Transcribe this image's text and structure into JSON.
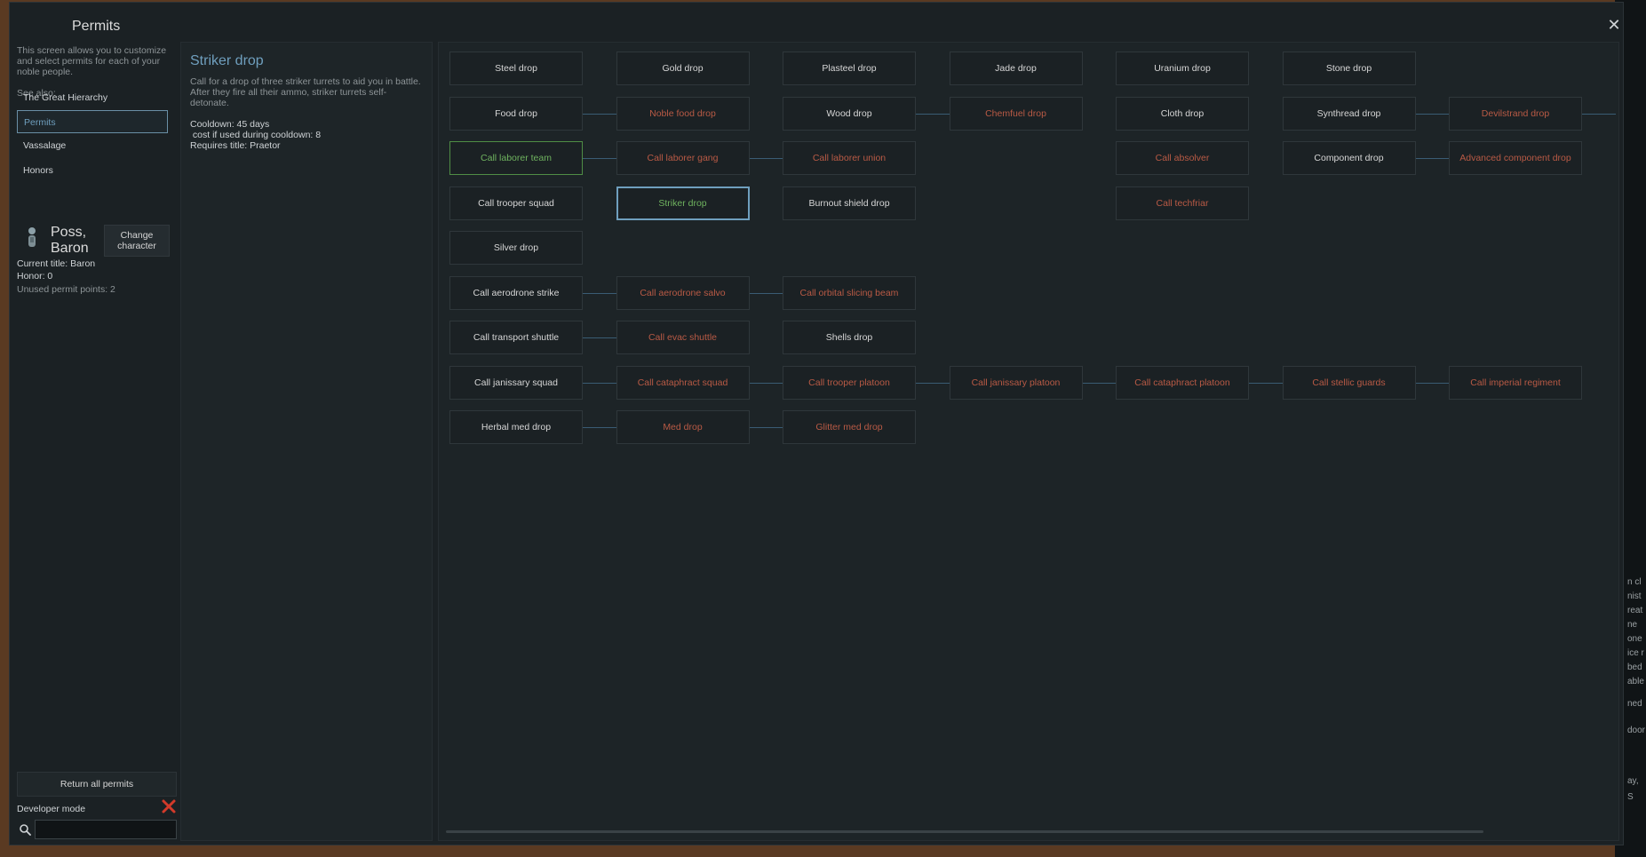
{
  "window": {
    "title": "Permits",
    "close_label": "✕"
  },
  "left": {
    "description": "This screen allows you to customize and select permits for each of your noble people.",
    "see_also": "See also:",
    "nav": [
      "The Great Hierarchy",
      "Permits",
      "Vassalage",
      "Honors"
    ],
    "noble_name": "Poss, Baron",
    "change_character": "Change character",
    "current_title": "Current title: Baron",
    "honor": "Honor: 0",
    "unused_points": "Unused permit points: 2",
    "return_all": "Return all permits",
    "developer_mode": "Developer mode",
    "search_value": ""
  },
  "detail": {
    "title": "Striker drop",
    "description": "Call for a drop of three striker turrets to aid you in battle. After they fire all their ammo, striker turrets self-detonate.",
    "cooldown": "Cooldown: 45 days",
    "cooldown_cost": " cost if used during cooldown: 8",
    "requires": "Requires title: Praetor"
  },
  "permits": [
    {
      "label": "Steel drop",
      "col": 0,
      "row": 0,
      "state": "available"
    },
    {
      "label": "Gold drop",
      "col": 1,
      "row": 0,
      "state": "available"
    },
    {
      "label": "Plasteel drop",
      "col": 2,
      "row": 0,
      "state": "available"
    },
    {
      "label": "Jade drop",
      "col": 3,
      "row": 0,
      "state": "available"
    },
    {
      "label": "Uranium drop",
      "col": 4,
      "row": 0,
      "state": "available"
    },
    {
      "label": "Stone drop",
      "col": 5,
      "row": 0,
      "state": "available"
    },
    {
      "label": "Food drop",
      "col": 0,
      "row": 1,
      "state": "available"
    },
    {
      "label": "Noble food drop",
      "col": 1,
      "row": 1,
      "state": "locked"
    },
    {
      "label": "Wood drop",
      "col": 2,
      "row": 1,
      "state": "available"
    },
    {
      "label": "Chemfuel drop",
      "col": 3,
      "row": 1,
      "state": "locked"
    },
    {
      "label": "Cloth drop",
      "col": 4,
      "row": 1,
      "state": "available"
    },
    {
      "label": "Synthread drop",
      "col": 5,
      "row": 1,
      "state": "available"
    },
    {
      "label": "Devilstrand drop",
      "col": 6,
      "row": 1,
      "state": "locked"
    },
    {
      "label": "Call laborer team",
      "col": 0,
      "row": 2,
      "state": "owned"
    },
    {
      "label": "Call laborer gang",
      "col": 1,
      "row": 2,
      "state": "locked"
    },
    {
      "label": "Call laborer union",
      "col": 2,
      "row": 2,
      "state": "locked"
    },
    {
      "label": "Call absolver",
      "col": 4,
      "row": 2,
      "state": "locked"
    },
    {
      "label": "Component drop",
      "col": 5,
      "row": 2,
      "state": "available"
    },
    {
      "label": "Advanced component drop",
      "col": 6,
      "row": 2,
      "state": "locked"
    },
    {
      "label": "Call trooper squad",
      "col": 0,
      "row": 3,
      "state": "available"
    },
    {
      "label": "Striker drop",
      "col": 1,
      "row": 3,
      "state": "selected"
    },
    {
      "label": "Burnout shield drop",
      "col": 2,
      "row": 3,
      "state": "available"
    },
    {
      "label": "Call techfriar",
      "col": 4,
      "row": 3,
      "state": "locked"
    },
    {
      "label": "Silver drop",
      "col": 0,
      "row": 4,
      "state": "available"
    },
    {
      "label": "Call aerodrone strike",
      "col": 0,
      "row": 5,
      "state": "available"
    },
    {
      "label": "Call aerodrone salvo",
      "col": 1,
      "row": 5,
      "state": "locked"
    },
    {
      "label": "Call orbital slicing beam",
      "col": 2,
      "row": 5,
      "state": "locked"
    },
    {
      "label": "Call transport shuttle",
      "col": 0,
      "row": 6,
      "state": "available"
    },
    {
      "label": "Call evac shuttle",
      "col": 1,
      "row": 6,
      "state": "locked"
    },
    {
      "label": "Shells drop",
      "col": 2,
      "row": 6,
      "state": "available"
    },
    {
      "label": "Call janissary squad",
      "col": 0,
      "row": 7,
      "state": "available"
    },
    {
      "label": "Call cataphract squad",
      "col": 1,
      "row": 7,
      "state": "locked"
    },
    {
      "label": "Call trooper platoon",
      "col": 2,
      "row": 7,
      "state": "locked"
    },
    {
      "label": "Call janissary platoon",
      "col": 3,
      "row": 7,
      "state": "locked"
    },
    {
      "label": "Call cataphract platoon",
      "col": 4,
      "row": 7,
      "state": "locked"
    },
    {
      "label": "Call stellic guards",
      "col": 5,
      "row": 7,
      "state": "locked"
    },
    {
      "label": "Call imperial regiment",
      "col": 6,
      "row": 7,
      "state": "locked"
    },
    {
      "label": "Herbal med drop",
      "col": 0,
      "row": 8,
      "state": "available"
    },
    {
      "label": "Med drop",
      "col": 1,
      "row": 8,
      "state": "locked"
    },
    {
      "label": "Glitter med drop",
      "col": 2,
      "row": 8,
      "state": "locked"
    }
  ],
  "connections": [
    {
      "row": 1,
      "from": 0,
      "to": 1
    },
    {
      "row": 1,
      "from": 2,
      "to": 3
    },
    {
      "row": 1,
      "from": 5,
      "to": 6
    },
    {
      "row": 1,
      "from": 6,
      "to": 7
    },
    {
      "row": 2,
      "from": 0,
      "to": 1
    },
    {
      "row": 2,
      "from": 1,
      "to": 2
    },
    {
      "row": 2,
      "from": 5,
      "to": 6
    },
    {
      "row": 5,
      "from": 0,
      "to": 1
    },
    {
      "row": 5,
      "from": 1,
      "to": 2
    },
    {
      "row": 6,
      "from": 0,
      "to": 1
    },
    {
      "row": 7,
      "from": 0,
      "to": 1
    },
    {
      "row": 7,
      "from": 1,
      "to": 2
    },
    {
      "row": 7,
      "from": 2,
      "to": 3
    },
    {
      "row": 7,
      "from": 3,
      "to": 4
    },
    {
      "row": 7,
      "from": 4,
      "to": 5
    },
    {
      "row": 7,
      "from": 5,
      "to": 6
    },
    {
      "row": 8,
      "from": 0,
      "to": 1
    },
    {
      "row": 8,
      "from": 1,
      "to": 2
    }
  ],
  "background_fragments": [
    "n cl",
    "nist",
    "reat",
    "ne",
    "one",
    "ice r",
    "bed",
    "able",
    "ned",
    "door",
    "ay,",
    "S"
  ],
  "colors": {
    "accent": "#6f9fbe",
    "locked": "#b95a45",
    "owned": "#6fb35f",
    "panel": "#1b2124"
  }
}
